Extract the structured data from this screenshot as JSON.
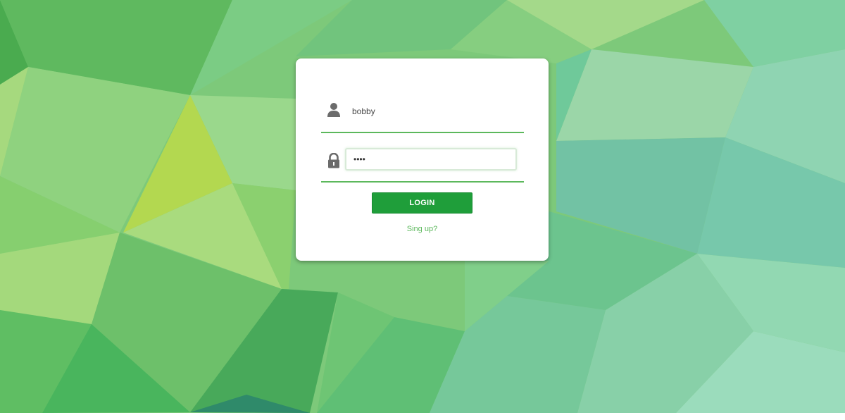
{
  "login_form": {
    "username_value": "bobby",
    "password_value": "••••",
    "login_label": "LOGIN",
    "signup_label": "Sing up?"
  },
  "icons": {
    "user": "user-icon",
    "password": "lock-icon"
  },
  "colors": {
    "accent": "#5cb85c",
    "button": "#1f9e3a",
    "card": "#ffffff"
  }
}
